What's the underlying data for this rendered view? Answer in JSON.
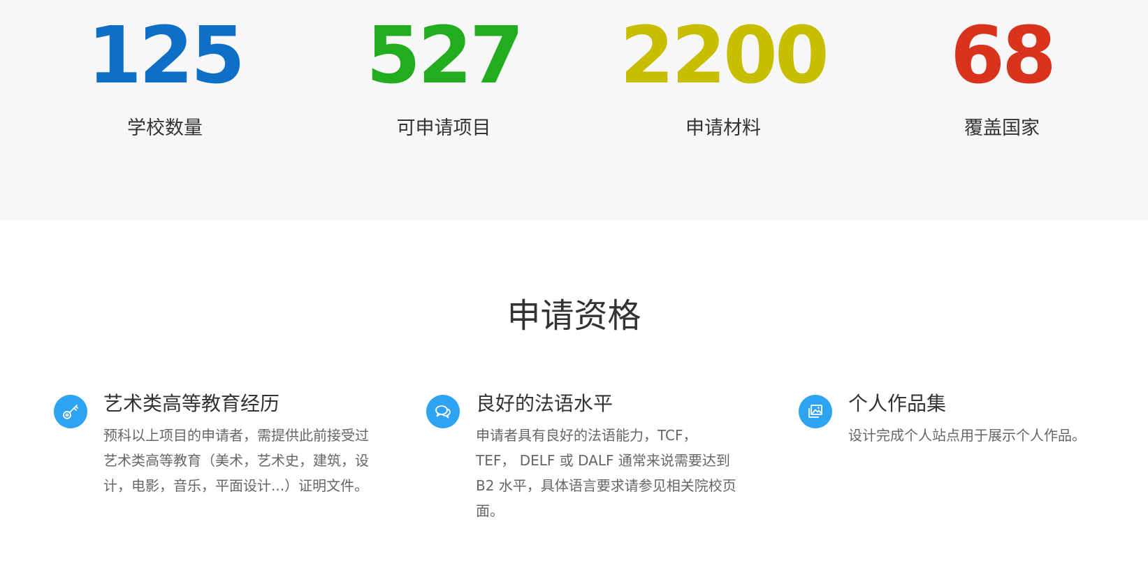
{
  "stats": [
    {
      "number": "125",
      "label": "学校数量",
      "color": "#0e6fc7"
    },
    {
      "number": "527",
      "label": "可申请项目",
      "color": "#22ad1f"
    },
    {
      "number": "2200",
      "label": "申请材料",
      "color": "#c8be00"
    },
    {
      "number": "68",
      "label": "覆盖国家",
      "color": "#d9321d"
    }
  ],
  "eligibility": {
    "title": "申请资格",
    "accent_color": "#2ea3f2",
    "features": [
      {
        "icon": "key-icon",
        "title": "艺术类高等教育经历",
        "description": "预科以上项目的申请者，需提供此前接受过艺术类高等教育（美术，艺术史，建筑，设计，电影，音乐，平面设计...）证明文件。"
      },
      {
        "icon": "chat-bubbles-icon",
        "title": "良好的法语水平",
        "description": "申请者具有良好的法语能力，TCF， TEF， DELF 或 DALF 通常来说需要达到 B2 水平，具体语言要求请参见相关院校页面。"
      },
      {
        "icon": "image-gallery-icon",
        "title": "个人作品集",
        "description": "设计完成个人站点用于展示个人作品。"
      }
    ]
  }
}
